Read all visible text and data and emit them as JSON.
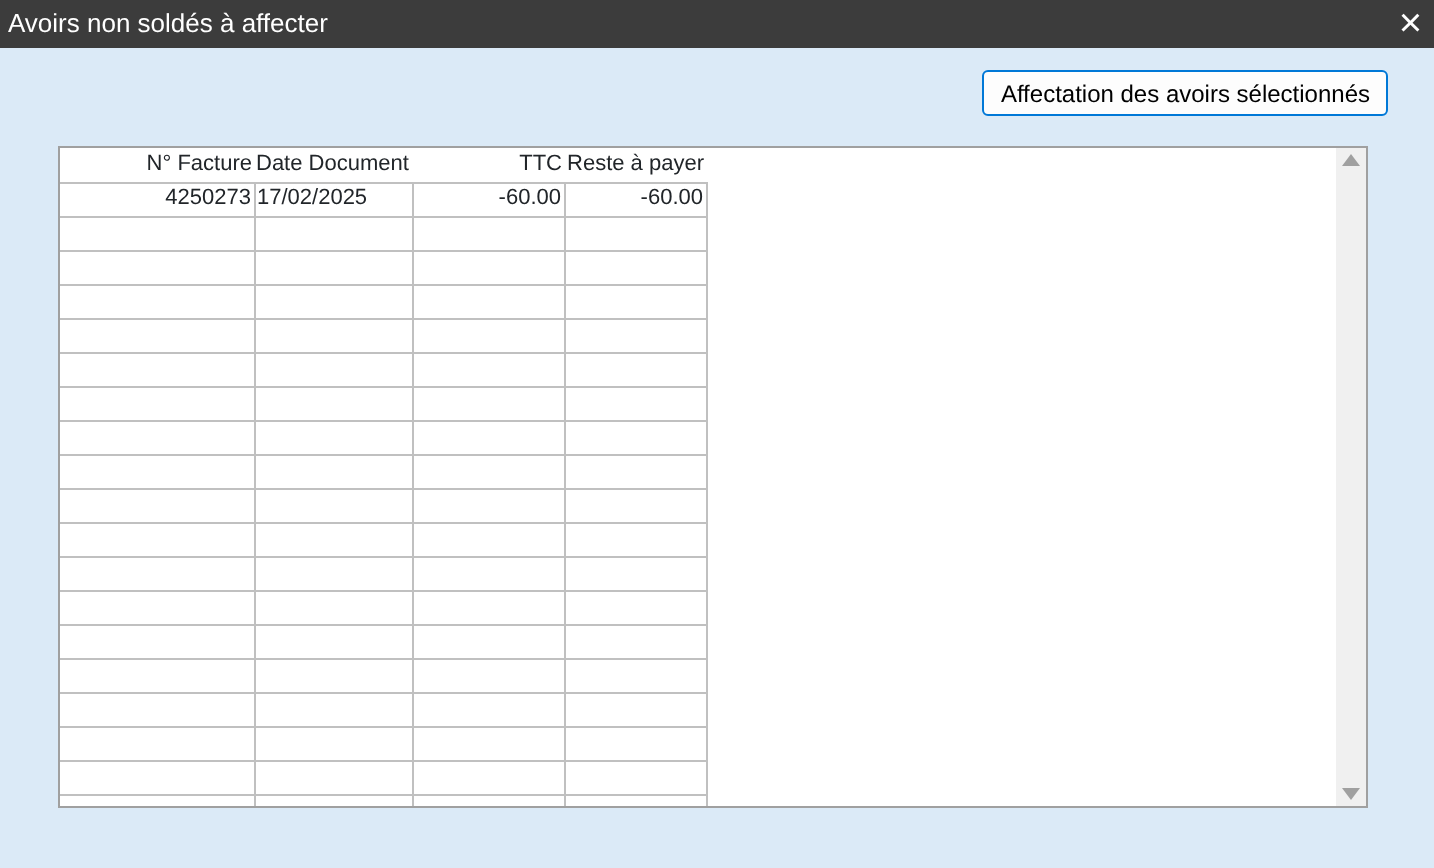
{
  "window": {
    "title": "Avoirs non soldés à affecter",
    "close": "×"
  },
  "button": "Affectation des avoirs sélectionnés",
  "table": {
    "columns": [
      {
        "label": "N° Facture",
        "kind": "number"
      },
      {
        "label": "Date Document",
        "kind": "date"
      },
      {
        "label": "TTC",
        "kind": "number"
      },
      {
        "label": "Reste à payer",
        "kind": "number"
      }
    ],
    "rows": [
      [
        "4250273",
        "17/02/2025",
        "-60.00",
        "-60.00"
      ]
    ]
  }
}
